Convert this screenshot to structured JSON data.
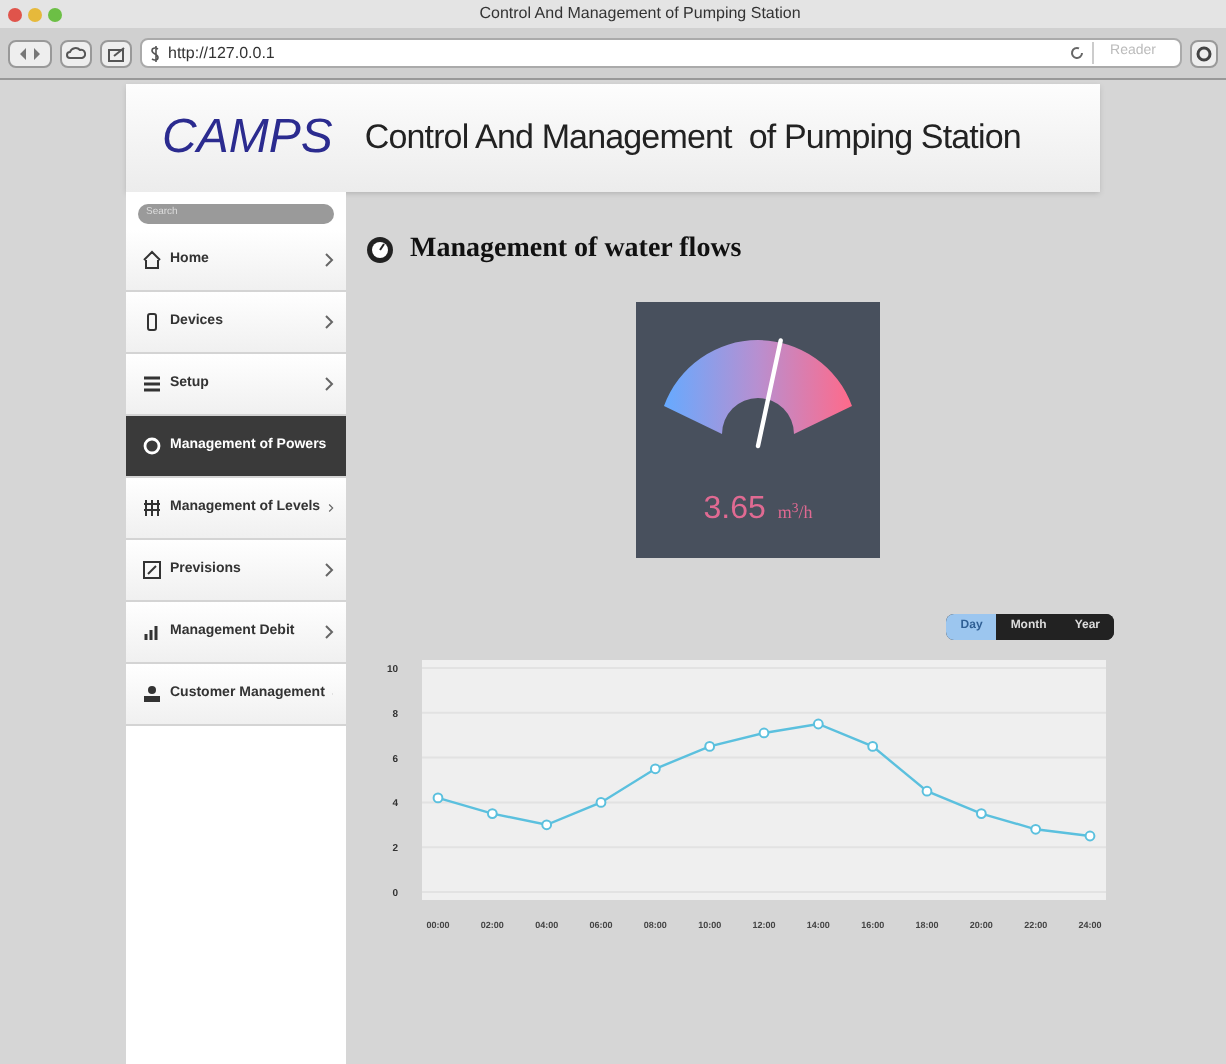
{
  "window": {
    "title": "Control And Management of Pumping Station"
  },
  "toolbar": {
    "url": "http://127.0.0.1",
    "reader": "Reader"
  },
  "header": {
    "logo": "CAMPS",
    "title": "Control And Management  of Pumping Station"
  },
  "sidebar": {
    "search": {
      "placeholder": "Search"
    },
    "items": [
      {
        "label": "Home",
        "selected": false
      },
      {
        "label": "Devices",
        "selected": false
      },
      {
        "label": "Setup",
        "selected": false
      },
      {
        "label": "Management of Powers",
        "selected": true
      },
      {
        "label": "Management of Levels",
        "selected": false
      },
      {
        "label": "Previsions",
        "selected": false
      },
      {
        "label": "Management Debit",
        "selected": false
      },
      {
        "label": "Customer Management",
        "selected": false
      }
    ]
  },
  "section": {
    "title": "Management of water flows"
  },
  "gauge": {
    "value": "3.65",
    "unit": "m$^{3}$/h"
  },
  "periods": [
    {
      "label": "Day",
      "selected": true
    },
    {
      "label": "Month",
      "selected": false
    },
    {
      "label": "Year",
      "selected": false
    }
  ],
  "chart": {
    "chart_data": {
      "type": "line",
      "categories": [
        "00:00",
        "02:00",
        "04:00",
        "06:00",
        "08:00",
        "10:00",
        "12:00",
        "14:00",
        "16:00",
        "18:00",
        "20:00",
        "22:00",
        "24:00"
      ],
      "ylim": [
        0,
        10
      ],
      "yticks": [
        0,
        2,
        4,
        6,
        8,
        10
      ],
      "grid": true,
      "series": [
        {
          "color": "#5bc0de",
          "marker": "circle",
          "values": [
            4.2,
            3.5,
            3,
            4,
            5.5,
            6.5,
            7.1,
            7.5,
            6.5,
            4.5,
            3.5,
            2.8,
            2.5
          ]
        }
      ]
    }
  }
}
